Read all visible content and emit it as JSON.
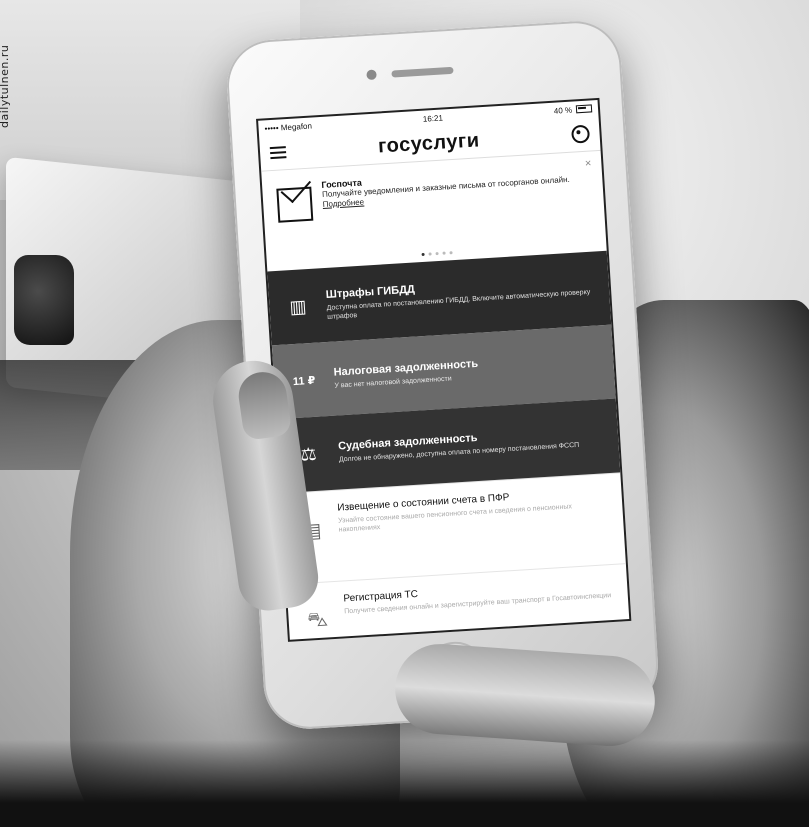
{
  "watermark": "dailytulnen.ru",
  "phone": {
    "status_bar": {
      "carrier": "••••• Megafon",
      "time": "16:21",
      "battery": "40 %"
    },
    "navbar": {
      "title": "госуслуги"
    },
    "notice": {
      "title": "Госпочта",
      "text": "Получайте уведомления и заказные письма от госорганов онлайн.",
      "link": "Подробнее",
      "close": "×"
    },
    "cards": [
      {
        "title": "Штрафы ГИБДД",
        "desc": "Доступна оплата по постановлению ГИБДД. Включите автоматическую проверку штрафов",
        "icon": "traffic-light-icon"
      },
      {
        "title": "Налоговая задолженность",
        "desc": "У вас нет налоговой задолженности",
        "icon": "rub-icon",
        "amount": "11 ₽"
      },
      {
        "title": "Судебная задолженность",
        "desc": "Долгов не обнаружено, доступна оплата по номеру постановления ФССП",
        "icon": "scales-icon"
      }
    ],
    "list": [
      {
        "title": "Извещение о состоянии счета в ПФР",
        "desc": "Узнайте состояние вашего пенсионного счета и сведения о пенсионных накоплениях",
        "icon": "document-icon"
      },
      {
        "title": "Регистрация ТС",
        "desc": "Получите сведения онлайн и зарегистрируйте ваш транспорт в Госавтоинспекции",
        "icon": "car-icon"
      }
    ]
  },
  "colors": {
    "dark_card": "#2b2b2b",
    "mid_card": "#6a6a6a"
  }
}
